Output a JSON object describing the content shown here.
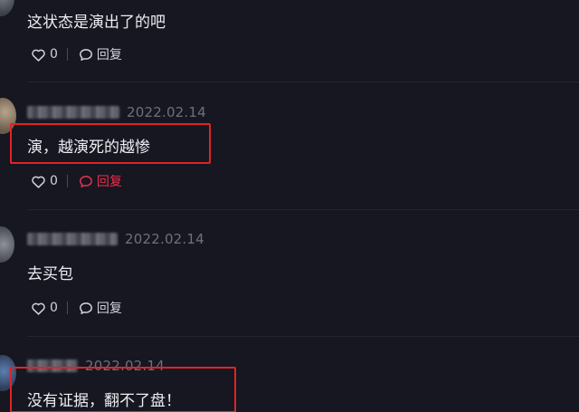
{
  "comments": [
    {
      "text": "这状态是演出了的吧",
      "likes": "0",
      "reply_label": "回复"
    },
    {
      "date": "2022.02.14",
      "text": "演，越演死的越惨",
      "likes": "0",
      "reply_label": "回复"
    },
    {
      "date": "2022.02.14",
      "text": "去买包",
      "likes": "0",
      "reply_label": "回复"
    },
    {
      "date": "2022.02.14",
      "text": "没有证据，翻不了盘！"
    }
  ],
  "colors": {
    "background": "#161720",
    "reply_active": "#e8304f",
    "highlight_box": "#e02424"
  },
  "icons": [
    "heart-icon",
    "comment-bubble-icon"
  ]
}
